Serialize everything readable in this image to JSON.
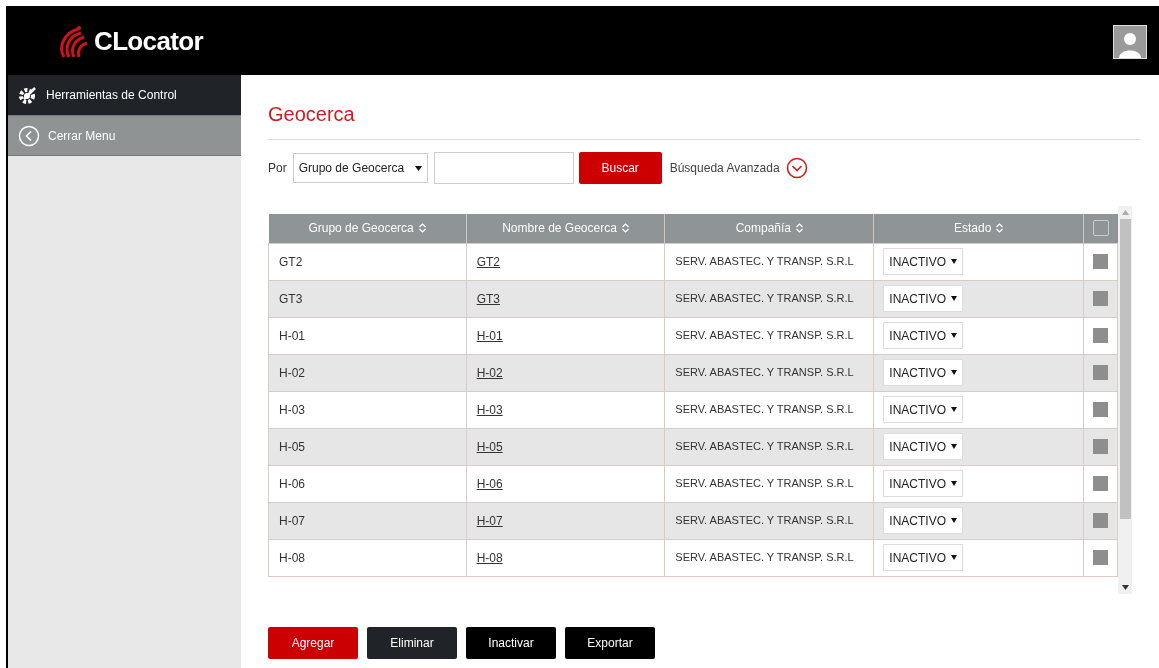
{
  "header": {
    "logo": "CLocator"
  },
  "sidebar": {
    "items": [
      {
        "label": "Herramientas de Control",
        "kind": "tools"
      },
      {
        "label": "Cerrar Menu",
        "kind": "close"
      }
    ]
  },
  "page": {
    "title": "Geocerca"
  },
  "filter": {
    "label": "Por",
    "select": "Grupo de Geocerca",
    "search_button": "Buscar",
    "advanced": "Búsqueda Avanzada"
  },
  "table": {
    "columns": [
      "Grupo de Geocerca",
      "Nombre de Geocerca",
      "Compañía",
      "Estado"
    ],
    "select_all": {
      "checked": false
    },
    "rows": [
      {
        "group": "GT2",
        "name": "GT2",
        "company": "SERV. ABASTEC. Y TRANSP. S.R.L",
        "status": "INACTIVO",
        "checked": false
      },
      {
        "group": "GT3",
        "name": "GT3",
        "company": "SERV. ABASTEC. Y TRANSP. S.R.L",
        "status": "INACTIVO",
        "checked": false
      },
      {
        "group": "H-01",
        "name": "H-01",
        "company": "SERV. ABASTEC. Y TRANSP. S.R.L",
        "status": "INACTIVO",
        "checked": false
      },
      {
        "group": "H-02",
        "name": "H-02",
        "company": "SERV. ABASTEC. Y TRANSP. S.R.L",
        "status": "INACTIVO",
        "checked": false
      },
      {
        "group": "H-03",
        "name": "H-03",
        "company": "SERV. ABASTEC. Y TRANSP. S.R.L",
        "status": "INACTIVO",
        "checked": false
      },
      {
        "group": "H-05",
        "name": "H-05",
        "company": "SERV. ABASTEC. Y TRANSP. S.R.L",
        "status": "INACTIVO",
        "checked": false
      },
      {
        "group": "H-06",
        "name": "H-06",
        "company": "SERV. ABASTEC. Y TRANSP. S.R.L",
        "status": "INACTIVO",
        "checked": false
      },
      {
        "group": "H-07",
        "name": "H-07",
        "company": "SERV. ABASTEC. Y TRANSP. S.R.L",
        "status": "INACTIVO",
        "checked": false
      },
      {
        "group": "H-08",
        "name": "H-08",
        "company": "SERV. ABASTEC. Y TRANSP. S.R.L",
        "status": "INACTIVO",
        "checked": false
      }
    ]
  },
  "actions": [
    {
      "label": "Agregar",
      "kind": "primary"
    },
    {
      "label": "Eliminar",
      "kind": "dark"
    },
    {
      "label": "Inactivar",
      "kind": "black"
    },
    {
      "label": "Exportar",
      "kind": "black"
    }
  ]
}
